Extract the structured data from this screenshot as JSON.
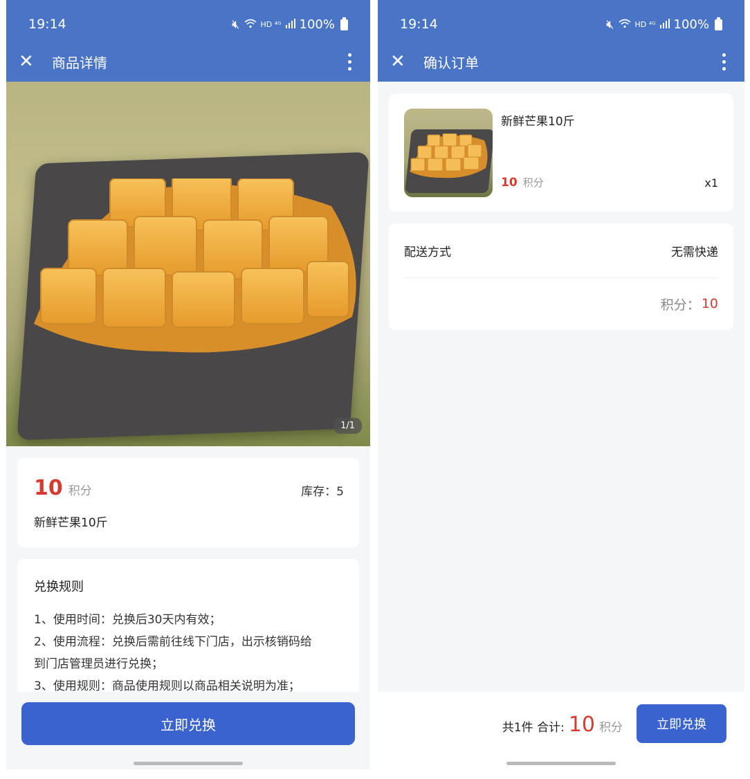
{
  "screen1": {
    "status": {
      "time": "19:14",
      "network": "HD ⁴ᴳ",
      "battery": "100%"
    },
    "appbar": {
      "title": "商品详情"
    },
    "hero": {
      "page_indicator": "1/1"
    },
    "product": {
      "price": "10",
      "unit": "积分",
      "stock": "库存：5",
      "name": "新鲜芒果10斤"
    },
    "rules": {
      "title": "兑换规则",
      "lines": [
        "1、使用时间：兑换后30天内有效；",
        "2、使用流程：兑换后需前往线下门店，出示核销码给",
        "到门店管理员进行兑换；",
        "3、使用规则：商品使用规则以商品相关说明为准；"
      ]
    },
    "button": "立即兑换"
  },
  "screen2": {
    "status": {
      "time": "19:14",
      "network": "HD ⁴ᴳ",
      "battery": "100%"
    },
    "appbar": {
      "title": "确认订单"
    },
    "item": {
      "name": "新鲜芒果10斤",
      "price": "10",
      "unit": "积分",
      "qty": "x1"
    },
    "shipping": {
      "label": "配送方式",
      "value": "无需快递",
      "points_label": "积分：",
      "points_value": "10"
    },
    "footer": {
      "count": "共1件 合计:",
      "total": "10",
      "unit": "积分",
      "button": "立即兑换"
    }
  },
  "colors": {
    "primary": "#4a74c5",
    "button": "#3a63cf",
    "price": "#d93a2f"
  }
}
